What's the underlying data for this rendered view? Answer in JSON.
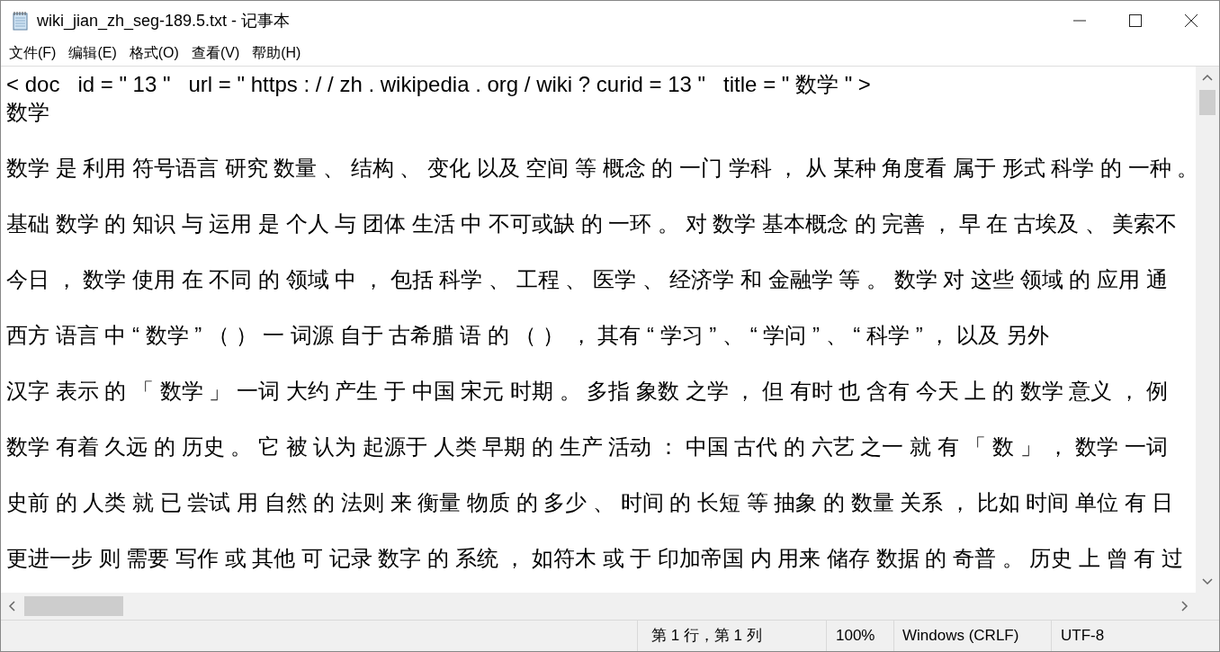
{
  "window": {
    "title": "wiki_jian_zh_seg-189.5.txt - 记事本"
  },
  "menu": [
    "文件(F)",
    "编辑(E)",
    "格式(O)",
    "查看(V)",
    "帮助(H)"
  ],
  "editor": {
    "header_lines": [
      "< doc   id = \" 13 \"   url = \" https : / / zh . wikipedia . org / wiki ? curid = 13 \"   title = \" 数学 \" >",
      "数学"
    ],
    "paragraphs": [
      "数学 是 利用 符号语言 研究 数量 、 结构 、 变化 以及 空间 等 概念 的 一门 学科 ， 从 某种 角度看 属于 形式 科学 的 一种 。",
      "基础 数学 的 知识 与 运用 是 个人 与 团体 生活 中 不可或缺 的 一环 。 对 数学 基本概念 的 完善 ， 早 在 古埃及 、 美索不",
      "今日 ， 数学 使用 在 不同 的 领域 中 ， 包括 科学 、 工程 、 医学 、 经济学 和 金融学 等 。 数学 对 这些 领域 的 应用 通",
      "西方 语言 中 “ 数学 ” （ ） 一 词源 自于 古希腊 语 的 （ ） ， 其有 “ 学习 ” 、 “ 学问 ” 、 “ 科学 ” ， 以及 另外",
      "汉字 表示 的 「 数学 」 一词 大约 产生 于 中国 宋元 时期 。 多指 象数 之学 ， 但 有时 也 含有 今天 上 的 数学 意义 ， 例",
      "数学 有着 久远 的 历史 。 它 被 认为 起源于 人类 早期 的 生产 活动 ： 中国 古代 的 六艺 之一 就 有 「 数 」 ， 数学 一词",
      "史前 的 人类 就 已 尝试 用 自然 的 法则 来 衡量 物质 的 多少 、 时间 的 长短 等 抽象 的 数量 关系 ， 比如 时间 单位 有 日",
      "更进一步 则 需要 写作 或 其他 可 记录 数字 的 系统 ， 如符木 或 于 印加帝国 内 用来 储存 数据 的 奇普 。 历史 上 曾 有 过"
    ]
  },
  "status_bar": [
    "第 1 行，第 1 列",
    "100%",
    "Windows (CRLF)",
    "UTF-8"
  ]
}
